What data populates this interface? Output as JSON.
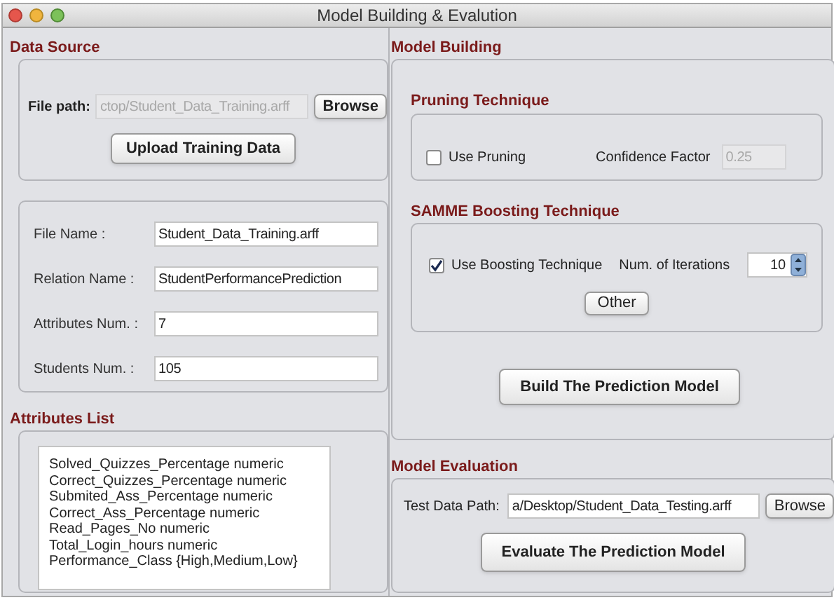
{
  "window": {
    "title": "Model Building & Evalution"
  },
  "data_source": {
    "title": "Data Source",
    "file_path": {
      "label": "File path:",
      "value": "ctop/Student_Data_Training.arff",
      "disabled": true
    },
    "browse_button": "Browse",
    "upload_button": "Upload Training Data"
  },
  "info_fields": [
    {
      "label": "File Name :",
      "value": "Student_Data_Training.arff"
    },
    {
      "label": "Relation Name :",
      "value": "StudentPerformancePrediction"
    },
    {
      "label": "Attributes Num. :",
      "value": "7"
    },
    {
      "label": "Students Num. :",
      "value": "105"
    }
  ],
  "attributes_list": {
    "title": "Attributes List",
    "items": [
      "Solved_Quizzes_Percentage numeric",
      "Correct_Quizzes_Percentage numeric",
      "Submited_Ass_Percentage numeric",
      "Correct_Ass_Percentage numeric",
      "Read_Pages_No numeric",
      "Total_Login_hours numeric",
      "Performance_Class {High,Medium,Low}"
    ]
  },
  "model_building": {
    "title": "Model Building",
    "pruning": {
      "title": "Pruning Technique",
      "checkbox": {
        "label": "Use Pruning",
        "checked": false
      },
      "confidence_factor": {
        "label": "Confidence Factor",
        "value": "0.25",
        "disabled": true
      }
    },
    "boosting": {
      "title": "SAMME Boosting Technique",
      "checkbox": {
        "label": "Use Boosting Technique",
        "checked": true
      },
      "iterations": {
        "label": "Num. of Iterations",
        "value": "10"
      },
      "other_button": "Other"
    },
    "build_button": "Build The Prediction Model"
  },
  "model_evaluation": {
    "title": "Model Evaluation",
    "test_path": {
      "label": "Test Data Path:",
      "value": "a/Desktop/Student_Data_Testing.arff"
    },
    "browse_button": "Browse",
    "evaluate_button": "Evaluate The Prediction Model"
  }
}
